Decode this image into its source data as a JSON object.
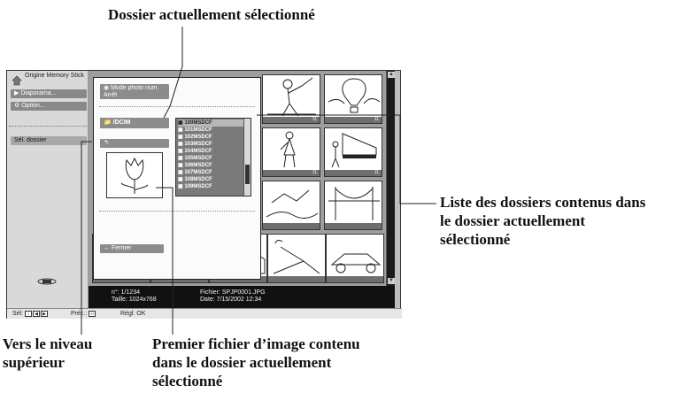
{
  "callouts": {
    "top": "Dossier actuellement sélectionné",
    "right_line1": "Liste des dossiers contenus dans",
    "right_line2": "le dossier actuellement",
    "right_line3": "sélectionné",
    "bottom_left_line1": "Vers le niveau",
    "bottom_left_line2": "supérieur",
    "bottom_mid_line1": "Premier fichier d’image contenu",
    "bottom_mid_line2": "dans le dossier actuellement",
    "bottom_mid_line3": "sélectionné"
  },
  "sidebar": {
    "home_label": "Origine Memory Stick",
    "slideshow": "Diaporama...",
    "option": "Option...",
    "select_folder": "Sél. dossier"
  },
  "panel": {
    "camera_mode": "Mode photo num.",
    "camera_state": "Arrêt",
    "current_path": "/DCIM",
    "close": "Fermer",
    "folders": [
      "100MSDCF",
      "101MSDCF",
      "102MSDCF",
      "103MSDCF",
      "104MSDCF",
      "105MSDCF",
      "106MSDCF",
      "107MSDCF",
      "108MSDCF",
      "109MSDCF"
    ]
  },
  "thumbnails": {
    "captions": [
      "11",
      "11",
      "11",
      "11"
    ]
  },
  "info": {
    "number": "n°: 1/1234",
    "size": "Taille: 1024x768",
    "file": "Fichier:  SPJP0001.JPG",
    "date": "Date:  7/15/2002 12:34"
  },
  "bottom_bar": {
    "select": "Sél:",
    "prev": "Préc.:",
    "set": "Régl: OK"
  },
  "icons": [
    "home-icon",
    "slideshow-icon",
    "option-icon",
    "camera-icon",
    "folder-icon",
    "up-folder-icon",
    "back-arrow-icon",
    "memory-stick-icon",
    "scroll-up-icon",
    "scroll-down-icon"
  ]
}
